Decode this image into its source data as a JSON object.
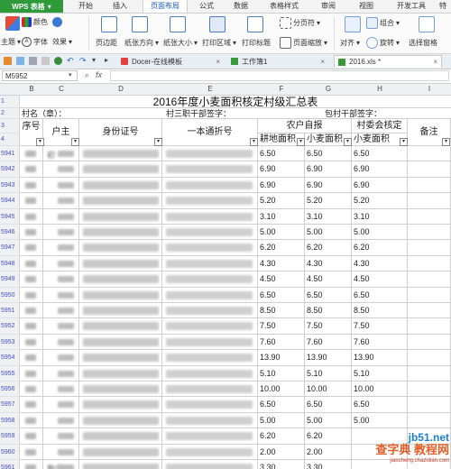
{
  "menu": {
    "app_label": "WPS 表格",
    "tabs": [
      "开始",
      "插入",
      "页面布局",
      "公式",
      "数据",
      "表格样式",
      "审阅",
      "视图",
      "开发工具",
      "特"
    ],
    "active_tab": "页面布局"
  },
  "ribbon": {
    "theme": "主题",
    "colors": "颜色",
    "fonts": "字体",
    "effects": "效果",
    "margins": "页边距",
    "orientation": "纸张方向",
    "size": "纸张大小",
    "print_area": "打印区域",
    "print_titles": "打印标题",
    "page_break": "分页符",
    "page_zoom": "页面缩放",
    "align": "对齐",
    "group": "组合",
    "rotate": "旋转",
    "selection_pane": "选择窗格",
    "page_break_dd": "▾"
  },
  "tabs": [
    {
      "label": "Docer-在线模板"
    },
    {
      "label": "工作簿1"
    },
    {
      "label": "2016.xls *"
    }
  ],
  "formula_bar": {
    "name_box": "M5952",
    "fx": "fx"
  },
  "sheet": {
    "columns": [
      "B",
      "C",
      "D",
      "E",
      "F",
      "G",
      "H",
      "I"
    ],
    "title": "2016年度小麦面积核定村级汇总表",
    "row2": {
      "village": "村名（章）：",
      "village_cadre": "村三职干部签字：",
      "town_cadre": "包村干部签字："
    },
    "headers": {
      "seq": "序号",
      "owner": "户主",
      "id_card": "身份证号",
      "passbook": "一本通折号",
      "self_report": "农户自报",
      "village_verify": "村委会核定",
      "land_area": "耕地面积",
      "wheat_area": "小麦面积",
      "wheat_area_v": "小麦面积",
      "remark": "备注"
    },
    "row_numbers": [
      "1",
      "2",
      "3",
      "4",
      "5941",
      "5942",
      "5943",
      "5944",
      "5945",
      "5946",
      "5947",
      "5948",
      "5949",
      "5950",
      "5951",
      "5952",
      "5953",
      "5954",
      "5955",
      "5956",
      "5957",
      "5958",
      "5959",
      "5960",
      "5961"
    ],
    "data_rows": [
      {
        "land": "6.50",
        "wheat": "6.50",
        "village": "6.50"
      },
      {
        "land": "6.90",
        "wheat": "6.90",
        "village": "6.90"
      },
      {
        "land": "6.90",
        "wheat": "6.90",
        "village": "6.90"
      },
      {
        "land": "5.20",
        "wheat": "5.20",
        "village": "5.20"
      },
      {
        "land": "3.10",
        "wheat": "3.10",
        "village": "3.10"
      },
      {
        "land": "5.00",
        "wheat": "5.00",
        "village": "5.00"
      },
      {
        "land": "6.20",
        "wheat": "6.20",
        "village": "6.20"
      },
      {
        "land": "4.30",
        "wheat": "4.30",
        "village": "4.30"
      },
      {
        "land": "4.50",
        "wheat": "4.50",
        "village": "4.50"
      },
      {
        "land": "6.50",
        "wheat": "6.50",
        "village": "6.50"
      },
      {
        "land": "8.50",
        "wheat": "8.50",
        "village": "8.50"
      },
      {
        "land": "7.50",
        "wheat": "7.50",
        "village": "7.50"
      },
      {
        "land": "7.60",
        "wheat": "7.60",
        "village": "7.60"
      },
      {
        "land": "13.90",
        "wheat": "13.90",
        "village": "13.90"
      },
      {
        "land": "5.10",
        "wheat": "5.10",
        "village": "5.10"
      },
      {
        "land": "10.00",
        "wheat": "10.00",
        "village": "10.00"
      },
      {
        "land": "6.50",
        "wheat": "6.50",
        "village": "6.50"
      },
      {
        "land": "5.00",
        "wheat": "5.00",
        "village": "5.00"
      },
      {
        "land": "6.20",
        "wheat": "6.20",
        "village": ""
      },
      {
        "land": "2.00",
        "wheat": "2.00",
        "village": ""
      },
      {
        "land": "3.30",
        "wheat": "3.30",
        "village": ""
      }
    ],
    "owner_fragments": [
      "初",
      "",
      "",
      "",
      "",
      "",
      "",
      "",
      "",
      "",
      "",
      "",
      "",
      "",
      "",
      "",
      "",
      "",
      "",
      "",
      "敖店"
    ]
  },
  "watermark": {
    "main": "jb51.net",
    "sub": "查字典 教程网",
    "url": "jiaocheng.chazidian.com"
  }
}
